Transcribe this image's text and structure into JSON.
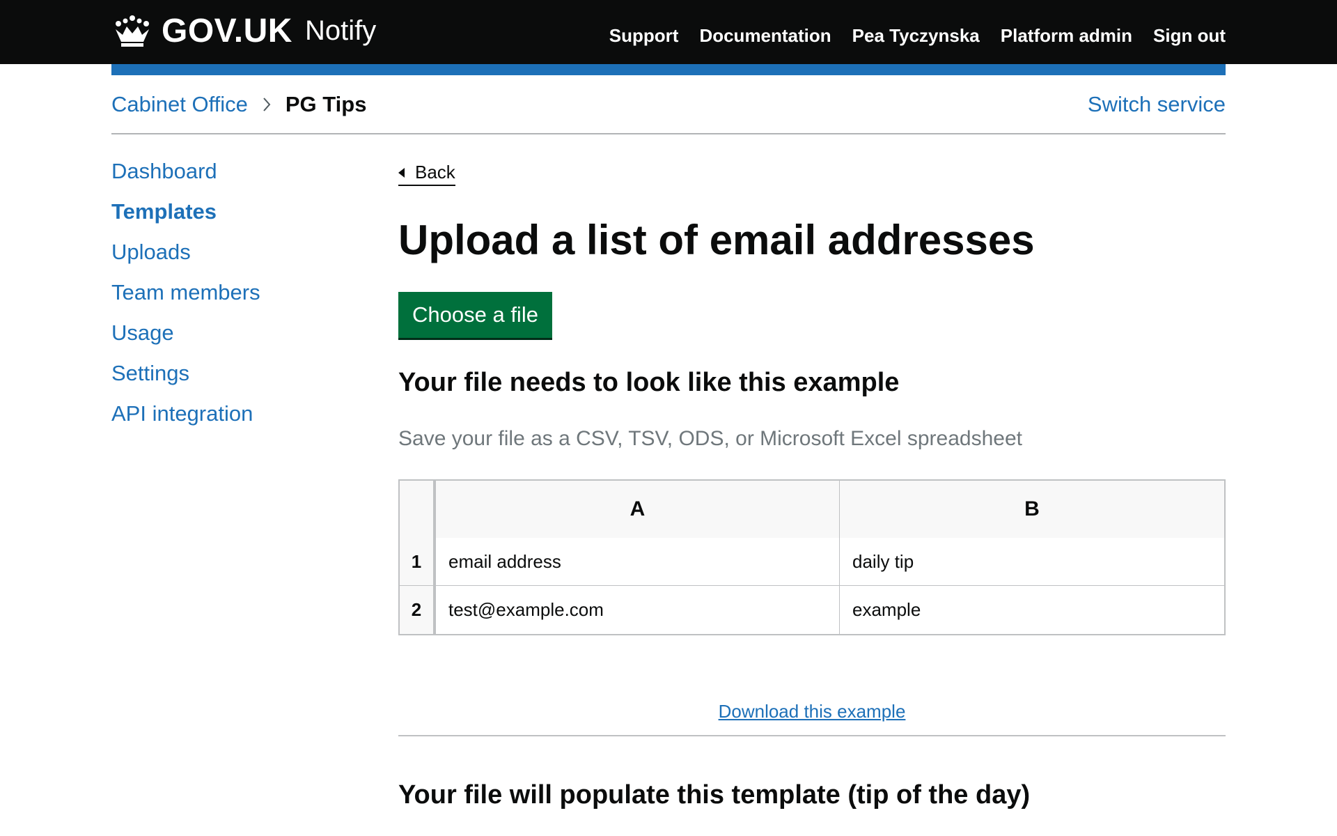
{
  "header": {
    "brand": "GOV.UK",
    "product": "Notify",
    "nav": [
      "Support",
      "Documentation",
      "Pea Tyczynska",
      "Platform admin",
      "Sign out"
    ]
  },
  "breadcrumb": {
    "organisation": "Cabinet Office",
    "service": "PG Tips",
    "switch_service": "Switch service"
  },
  "sidebar": {
    "items": [
      {
        "label": "Dashboard",
        "active": false
      },
      {
        "label": "Templates",
        "active": true
      },
      {
        "label": "Uploads",
        "active": false
      },
      {
        "label": "Team members",
        "active": false
      },
      {
        "label": "Usage",
        "active": false
      },
      {
        "label": "Settings",
        "active": false
      },
      {
        "label": "API integration",
        "active": false
      }
    ]
  },
  "main": {
    "back": "Back",
    "title": "Upload a list of email addresses",
    "choose_file": "Choose a file",
    "example_heading": "Your file needs to look like this example",
    "hint": "Save your file as a CSV, TSV, ODS, or Microsoft Excel spreadsheet",
    "example_table": {
      "columns": [
        "A",
        "B"
      ],
      "rows": [
        {
          "index": "1",
          "a": "email address",
          "b": "daily tip"
        },
        {
          "index": "2",
          "a": "test@example.com",
          "b": "example"
        }
      ]
    },
    "download_example": "Download this example",
    "template_heading": "Your file will populate this template (tip of the day)"
  },
  "colors": {
    "header_bg": "#0b0c0c",
    "blue_bar": "#1d70b8",
    "link": "#1d70b8",
    "button_green": "#00703c"
  },
  "icons": [
    "crown-icon",
    "chevron-right-icon",
    "back-arrow-icon"
  ]
}
